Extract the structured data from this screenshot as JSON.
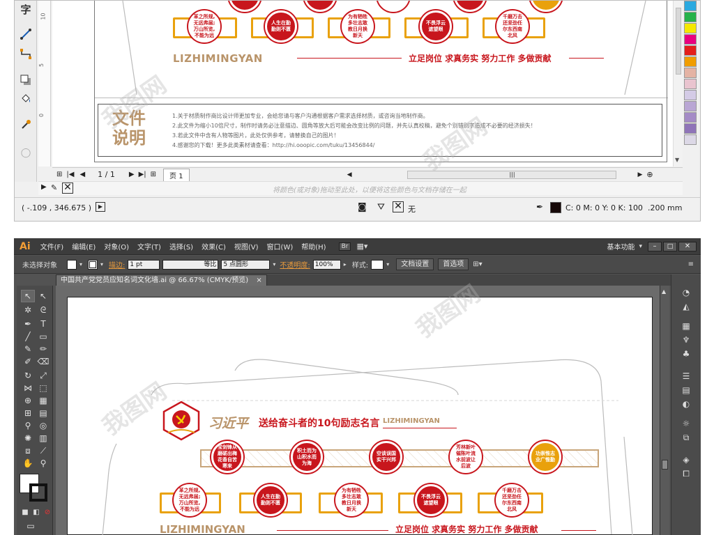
{
  "corel": {
    "toolbox_icons": [
      "text-icon",
      "dimension-icon",
      "connector-icon",
      "shadow-icon",
      "fill-icon",
      "eyedropper-icon",
      "outline-icon"
    ],
    "text_tool_glyph": "字",
    "ruler_ticks": [
      "10",
      "5",
      "0"
    ],
    "design": {
      "row2_circles": [
        "革之所规,无远弗届;万山所览,不能为远",
        "人生在勤勤则不匮",
        "为有牺牲多壮志敢教日月换新天",
        "不畏浮云遮望眼",
        "千磨万击还坚劲任尔东西南北风"
      ],
      "pinyin": "LIZHIMINGYAN",
      "slogan": "立足岗位 求真务实 努力工作 多做贡献"
    },
    "file_notes": {
      "title_line1": "文件",
      "title_line2": "说明",
      "lines": [
        "1.关于材质制作商比设计师更加专业，会给您请与客户沟通根据客户需求选择材质，或咨询当地制作商。",
        "2.此文件为缩小10倍尺寸，制作时请务必注意描边、圆角等放大后可能会改变比例的问题，并先认真校稿，避免个别错别字造成不必要的经济损失！",
        "3.若此文件中含有人物等图片，此处仅供参考，请替换自己的图片！",
        "4.感谢您的下载！更多此类素材请查看：http://hi.ooopic.com/tuku/13456844/"
      ]
    },
    "pagebar": {
      "page_counter": "1 / 1",
      "page_tab": "页 1"
    },
    "dock_hint": "将颜色(或对象)拖动至此处，以便将这些颜色与文档存储在一起",
    "status": {
      "coords": "( -.109 , 346.675 )",
      "fill_label": "无",
      "outline_color": "C: 0 M: 0 Y: 0 K: 100",
      "outline_width": ".200 mm"
    },
    "palette": [
      "#2aa9e0",
      "#27b24a",
      "#f5e800",
      "#e9007f",
      "#e41f1b",
      "#f09d00",
      "#e4b3a4",
      "#e9c4cf",
      "#d4cbe6",
      "#b9a6d4",
      "#a48bc6",
      "#8f74b8",
      "#dcd8e6"
    ]
  },
  "ai": {
    "logo": "Ai",
    "menus": [
      "文件(F)",
      "编辑(E)",
      "对象(O)",
      "文字(T)",
      "选择(S)",
      "效果(C)",
      "视图(V)",
      "窗口(W)",
      "帮助(H)"
    ],
    "bridge_label": "Br",
    "workspace": "基本功能",
    "control": {
      "selection_status": "未选择对象",
      "stroke_link": "描边:",
      "stroke_weight": "1 pt",
      "stroke_profile": "等比",
      "brush": "5 点圆形",
      "opacity_link": "不透明度:",
      "opacity": "100%",
      "style_label": "样式:",
      "doc_setup": "文档设置",
      "preferences": "首选项"
    },
    "tab": {
      "title": "中国共产党党员应知名词文化墙.ai @ 66.67% (CMYK/预览)",
      "close": "×"
    },
    "design": {
      "title_script": "习近平",
      "title": "送给奋斗者的10句励志名言",
      "title_pinyin": "LIZHIMINGYAN",
      "row1_circles": [
        "宝剑锋从磨砺出梅花香自苦寒来",
        "积土而为山积水而为海",
        "空谈误国实干兴邦",
        "芳林新叶催陈叶流水前波让后波",
        "功崇惟志业广惟勤"
      ],
      "row2_circles": [
        "革之所规,无远弗届;万山所览,不能为远",
        "人生在勤勤则不匮",
        "为有牺牲多壮志敢教日月换新天",
        "不畏浮云遮望眼",
        "千磨万击还坚劲任尔东西南北风"
      ],
      "pinyin": "LIZHIMINGYAN",
      "slogan": "立足岗位 求真务实 努力工作 多做贡献"
    }
  },
  "watermark": "我图网",
  "colors": {
    "party_red": "#c8161d",
    "gold": "#e9a10c",
    "tan": "#b9946a"
  }
}
